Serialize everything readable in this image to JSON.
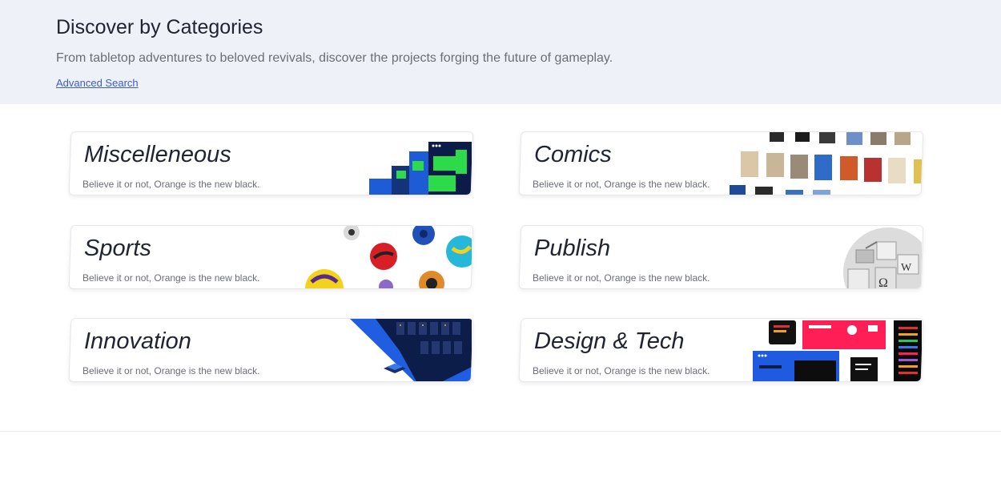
{
  "header": {
    "title": "Discover by Categories",
    "subtitle": "From tabletop adventures to beloved revivals, discover the projects forging the future of gameplay.",
    "advanced_search": "Advanced Search"
  },
  "categories": [
    {
      "title": "Miscelleneous",
      "description": "Believe it or not, Orange is the new black."
    },
    {
      "title": "Comics",
      "description": "Believe it or not, Orange is the new black."
    },
    {
      "title": "Sports",
      "description": "Believe it or not, Orange is the new black."
    },
    {
      "title": "Publish",
      "description": "Believe it or not, Orange is the new black."
    },
    {
      "title": "Innovation",
      "description": "Believe it or not, Orange is the new black."
    },
    {
      "title": "Design & Tech",
      "description": "Believe it or not, Orange is the new black."
    }
  ],
  "colors": {
    "hero_background": "#eef1f8",
    "link": "#3a5bd6",
    "title_text": "#1f2430",
    "body_text": "#6b6e76"
  }
}
